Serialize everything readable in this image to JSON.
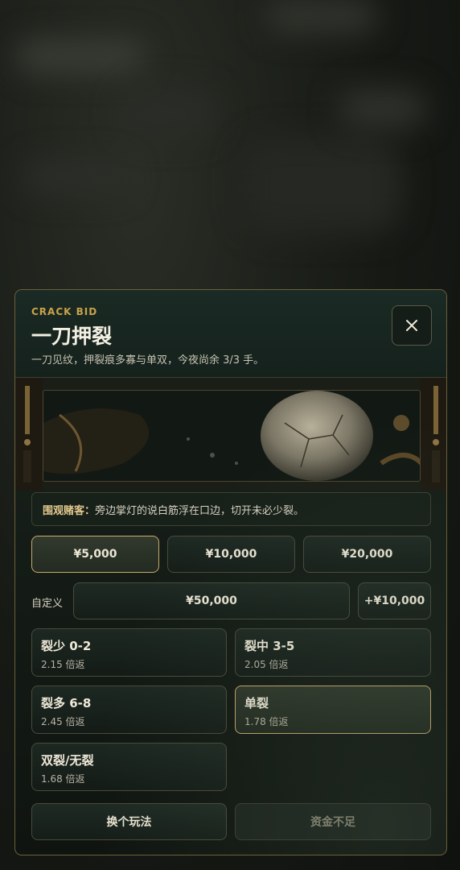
{
  "dialog": {
    "eyebrow": "CRACK BID",
    "title": "一刀押裂",
    "subtitle": "一刀见纹，押裂痕多寡与单双，今夜尚余 3/3 手。"
  },
  "notice": {
    "speaker": "围观赌客：",
    "text": "旁边掌灯的说白筋浮在口边，切开未必少裂。"
  },
  "stakes": [
    {
      "label": "¥5,000",
      "selected": true
    },
    {
      "label": "¥10,000",
      "selected": false
    },
    {
      "label": "¥20,000",
      "selected": false
    }
  ],
  "custom": {
    "label": "自定义",
    "value": "¥50,000",
    "increment": "+¥10,000"
  },
  "options": [
    {
      "name": "裂少 0-2",
      "odds": "2.15 倍返",
      "selected": false
    },
    {
      "name": "裂中 3-5",
      "odds": "2.05 倍返",
      "selected": false
    },
    {
      "name": "裂多 6-8",
      "odds": "2.45 倍返",
      "selected": false
    },
    {
      "name": "单裂",
      "odds": "1.78 倍返",
      "selected": true
    },
    {
      "name": "双裂/无裂",
      "odds": "1.68 倍返",
      "selected": false
    }
  ],
  "footer": {
    "switch_label": "换个玩法",
    "confirm_label": "资金不足",
    "confirm_enabled": false
  },
  "icons": {
    "close": "close-icon"
  },
  "colors": {
    "accent_gold": "#c9a24a",
    "selected_border": "#c9a96a"
  }
}
